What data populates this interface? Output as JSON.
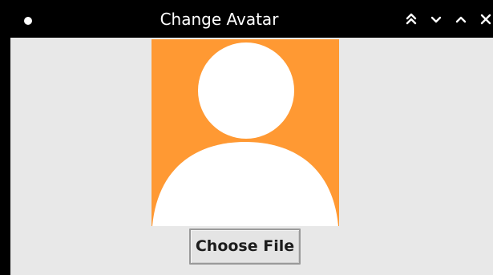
{
  "window": {
    "title": "Change Avatar",
    "menu_icon": "circle-dot-icon",
    "controls": [
      {
        "name": "shade",
        "icon": "double-chevron-up-icon"
      },
      {
        "name": "minimize",
        "icon": "chevron-down-icon"
      },
      {
        "name": "maximize",
        "icon": "chevron-up-icon"
      },
      {
        "name": "close",
        "icon": "close-icon"
      }
    ]
  },
  "avatar": {
    "icon": "default-user-avatar-icon",
    "background_color": "#ff9933",
    "figure_color": "#ffffff"
  },
  "actions": {
    "choose_file_label": "Choose File"
  },
  "colors": {
    "titlebar": "#000000",
    "content_background": "#e8e8e8"
  }
}
